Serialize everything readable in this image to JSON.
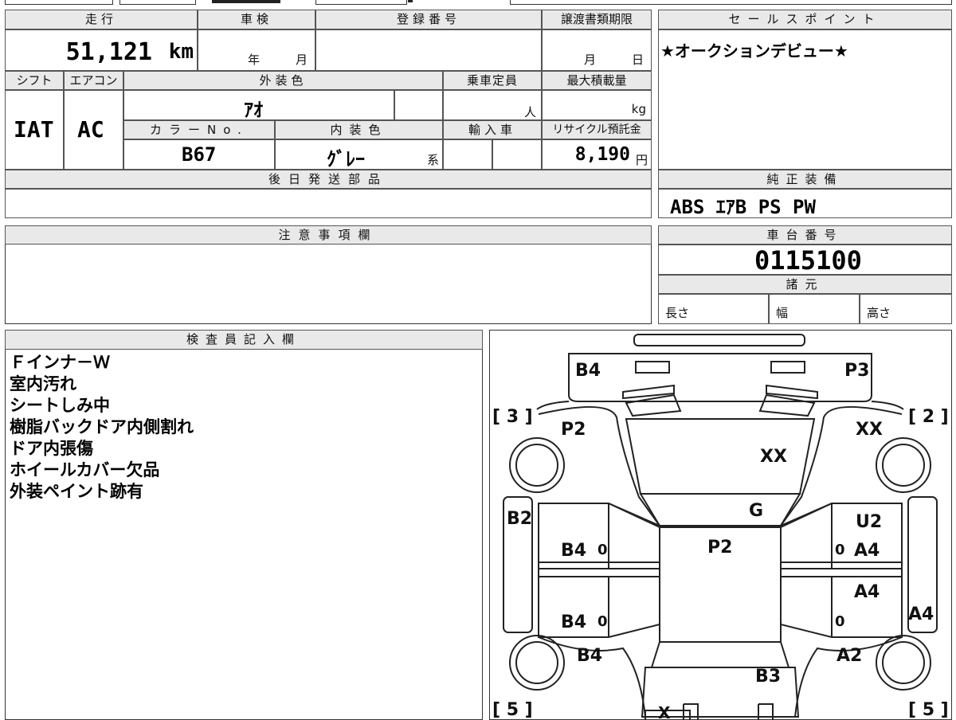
{
  "top": {
    "mileage_label": "走行",
    "mileage_value": "51,121",
    "mileage_unit": "km",
    "inspection_label": "車検",
    "inspection_year": "年",
    "inspection_month": "月",
    "registration_label": "登録番号",
    "registration_value": "",
    "transfer_label": "譲渡書類期限",
    "transfer_month": "月",
    "transfer_day": "日"
  },
  "spec": {
    "shift_label": "シフト",
    "shift_value": "IAT",
    "ac_label": "エアコン",
    "ac_value": "AC",
    "exterior_label": "外装色",
    "exterior_value": "ｱｵ",
    "capacity_label": "乗車定員",
    "capacity_unit": "人",
    "load_label": "最大積載量",
    "load_unit": "kg",
    "color_no_label": "カラーNo.",
    "color_no_value": "B67",
    "interior_label": "内装色",
    "interior_value": "ｸﾞﾚｰ",
    "interior_suffix": "系",
    "import_label": "輸入車",
    "recycle_label": "リサイクル預託金",
    "recycle_value": "8,190",
    "recycle_unit": "円",
    "later_parts_label": "後日発送部品"
  },
  "sales": {
    "label": "セールスポイント",
    "text": "★オークションデビュー★"
  },
  "equipment": {
    "label": "純正装備",
    "value": "ABS ｴｱB PS PW"
  },
  "notes": {
    "label": "注意事項欄",
    "text": ""
  },
  "chassis": {
    "label": "車台番号",
    "value": "0115100",
    "specs_label": "諸元",
    "length_label": "長さ",
    "width_label": "幅",
    "height_label": "高さ"
  },
  "inspector": {
    "label": "検査員記入欄",
    "lines": [
      "Ｆインナ－Ｗ",
      "室内汚れ",
      "シートしみ中",
      "樹脂バックドア内側割れ",
      "ドア内張傷",
      "ホイールカバー欠品",
      "外装ペイント跡有"
    ]
  },
  "diagram": {
    "marks": {
      "b4_top": "B4",
      "p3": "P3",
      "bracket_3": "[ 3 ]",
      "bracket_2": "[ 2 ]",
      "p2_upper": "P2",
      "xx_right": "XX",
      "xx_hood": "XX",
      "g": "G",
      "b2": "B2",
      "u2": "U2",
      "b4_rear_door": "B4",
      "zero_1": "0",
      "p2_roof": "P2",
      "zero_2": "0",
      "a4_rear_door": "A4",
      "a4_front_door": "A4",
      "b4_front_door": "B4",
      "zero_3": "0",
      "zero_4": "0",
      "a4_side": "A4",
      "b4_lower": "B4",
      "a2": "A2",
      "b3": "B3",
      "bracket_5l": "[ 5 ]",
      "bracket_5r": "[ 5 ]",
      "x_bottom": "X"
    }
  }
}
